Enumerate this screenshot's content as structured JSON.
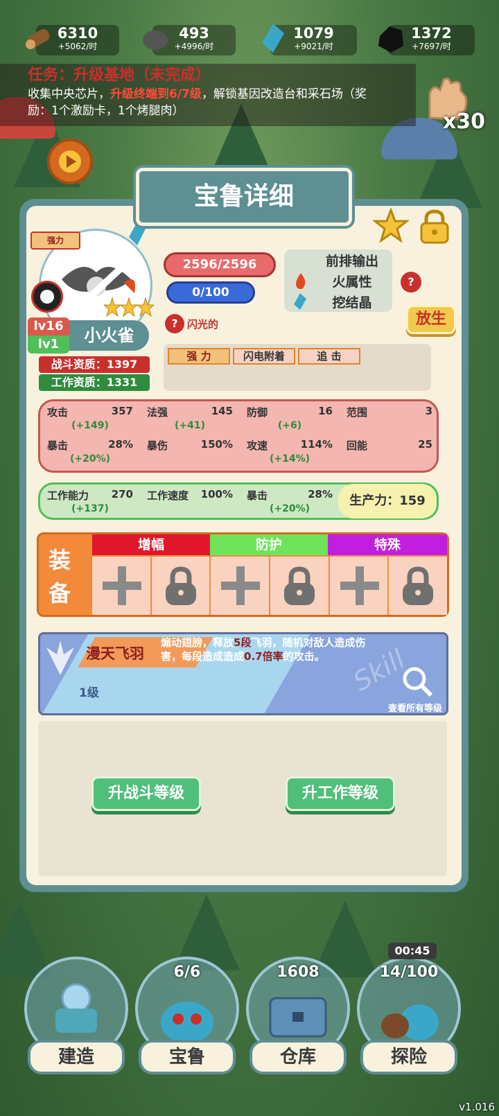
{
  "resources": [
    {
      "name": "wood",
      "value": "6310",
      "rate": "+5062/时",
      "color": "#8b5a2b"
    },
    {
      "name": "stone",
      "value": "493",
      "rate": "+4996/时",
      "color": "#6b6b6b"
    },
    {
      "name": "crystal",
      "value": "1079",
      "rate": "+9021/时",
      "color": "#3aa7c9"
    },
    {
      "name": "coal",
      "value": "1372",
      "rate": "+7697/时",
      "color": "#1c1c1c"
    }
  ],
  "task": {
    "title": "任务：升级基地（未完成）",
    "desc_a": "收集中央芯片，",
    "desc_hl": "升级终端到6/7级",
    "desc_b": "，解锁基因改造台和采石场（奖励：1个激励卡，1个烤腿肉）"
  },
  "glove_count": "x30",
  "panel": {
    "title": "宝鲁详细",
    "tag": "强力",
    "hp": "2596/2596",
    "energy": "0/100",
    "roles": [
      "前排输出",
      "火属性",
      "挖结晶"
    ],
    "release": "放生",
    "lv_battle": "lv16",
    "lv_work": "lv1",
    "pet_name": "小火雀",
    "battle_apt": "战斗资质：1397",
    "work_apt": "工作资质：1331",
    "trait": "闪光的",
    "traits": [
      "强 力",
      "闪电附着",
      "追 击"
    ],
    "stats": [
      {
        "name": "攻击",
        "value": "357",
        "bonus": "(+149)"
      },
      {
        "name": "法强",
        "value": "145",
        "bonus": "(+41)"
      },
      {
        "name": "防御",
        "value": "16",
        "bonus": "(+6)"
      },
      {
        "name": "范围",
        "value": "3",
        "bonus": ""
      },
      {
        "name": "暴击",
        "value": "28%",
        "bonus": "(+20%)"
      },
      {
        "name": "暴伤",
        "value": "150%",
        "bonus": ""
      },
      {
        "name": "攻速",
        "value": "114%",
        "bonus": "(+14%)"
      },
      {
        "name": "回能",
        "value": "25",
        "bonus": ""
      }
    ],
    "work_stats": [
      {
        "name": "工作能力",
        "value": "270",
        "bonus": "(+137)"
      },
      {
        "name": "工作速度",
        "value": "100%",
        "bonus": ""
      },
      {
        "name": "暴击",
        "value": "28%",
        "bonus": "(+20%)"
      }
    ],
    "productivity": "生产力：159",
    "equip_label_1": "装",
    "equip_label_2": "备",
    "equip_tabs": [
      {
        "label": "增幅",
        "color": "#e0162b"
      },
      {
        "label": "防护",
        "color": "#6fe35a"
      },
      {
        "label": "特殊",
        "color": "#c21ee0"
      }
    ],
    "skill": {
      "name": "漫天飞羽",
      "level": "1级",
      "desc_a": "煽动翅膀，释放",
      "n1": "5段",
      "desc_b": "飞羽，随机对敌人造成伤害，每段造成造成",
      "n2": "0.7倍率",
      "desc_c": "的攻击。",
      "watermark": "Skill",
      "view_all": "查看所有等级"
    },
    "btn_battle": "升战斗等级",
    "btn_work": "升工作等级"
  },
  "timer": "00:45",
  "nav": [
    {
      "label": "建造",
      "count": ""
    },
    {
      "label": "宝鲁",
      "count": "6/6"
    },
    {
      "label": "仓库",
      "count": "1608"
    },
    {
      "label": "探险",
      "count": "14/100"
    }
  ],
  "version": "v1.016"
}
